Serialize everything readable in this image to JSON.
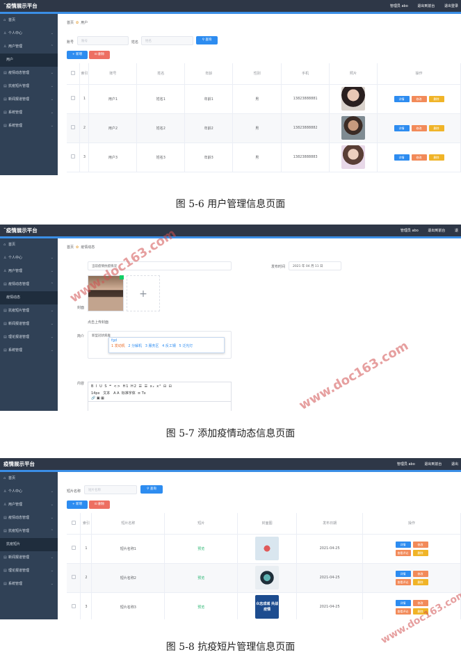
{
  "fig1": {
    "app_title": "ˉ疫情展示平台",
    "header_links": [
      "管理员 abo",
      "退出到前台",
      "退出登录"
    ],
    "sidebar": [
      "首页",
      "个人中心",
      "用户管理",
      "用户",
      "疫情动态管理",
      "抗疫短片管理",
      "新闻报道管理",
      "系统管理",
      "系统管理"
    ],
    "breadcrumb": {
      "home": "首页",
      "current": "用户"
    },
    "search": {
      "account_label": "账号",
      "account_placeholder": "账号",
      "name_label": "姓名",
      "name_placeholder": "姓名",
      "query_btn": "查询"
    },
    "actions": {
      "add": "新增",
      "delete": "删除"
    },
    "columns": [
      "索引",
      "账号",
      "姓名",
      "年龄",
      "性别",
      "手机",
      "照片",
      "操作"
    ],
    "rows": [
      {
        "idx": "1",
        "account": "用户1",
        "name": "姓名1",
        "age": "年龄1",
        "sex": "男",
        "phone": "13823888881"
      },
      {
        "idx": "2",
        "account": "用户2",
        "name": "姓名2",
        "age": "年龄2",
        "sex": "男",
        "phone": "13823888882"
      },
      {
        "idx": "3",
        "account": "用户3",
        "name": "姓名3",
        "age": "年龄3",
        "sex": "男",
        "phone": "13823888883"
      }
    ],
    "row_ops": [
      "详情",
      "修改",
      "删除"
    ],
    "caption": "图 5-6 用户管理信息页面"
  },
  "fig2": {
    "app_title": "ˉ疫情展示平台",
    "header_links": [
      "管理员 abo",
      "退出到前台",
      "退"
    ],
    "sidebar": [
      "首页",
      "个人中心",
      "用户管理",
      "疫情动态管理",
      "疫情动态",
      "抗疫短片管理",
      "新闻报道管理",
      "理论报道管理",
      "系统管理"
    ],
    "breadcrumb": {
      "home": "首页",
      "current": "疫情动态"
    },
    "title_value": "当前疫情抗疫情况",
    "date_label": "发布时间",
    "date_value": "2021 年 04 月 11 日",
    "cover_label": "封面",
    "cover_hint": "点击上传封面",
    "intro_label": "简介",
    "intro_value": "新型冠状病毒",
    "ime_input": "fgd",
    "ime_candidates": [
      "1 发动机",
      "2 分解机",
      "3 服务区",
      "4 反工钢",
      "5 泛光灯"
    ],
    "content_label": "内容",
    "editor_row1": [
      "B",
      "I",
      "U",
      "S",
      "❝",
      "<>",
      "H1",
      "H2",
      "☰",
      "☰",
      "x₂",
      "x²",
      "⊟",
      "⊟"
    ],
    "editor_row2": [
      "14px",
      "文本",
      "A",
      "A",
      "标准字体",
      "≡",
      "Tx"
    ],
    "caption": "图 5-7 添加疫情动态信息页面"
  },
  "fig3": {
    "app_title": "疫情展示平台",
    "header_links": [
      "管理员 abo",
      "退出到前台",
      "退出"
    ],
    "sidebar": [
      "首页",
      "个人中心",
      "用户管理",
      "疫情动态管理",
      "抗疫短片管理",
      "抗疫短片",
      "新闻报道管理",
      "理论报道管理",
      "系统管理"
    ],
    "search": {
      "label": "短片名称",
      "placeholder": "短片名称",
      "query_btn": "查询"
    },
    "actions": {
      "add": "新增",
      "delete": "删除"
    },
    "columns": [
      "索引",
      "短片名称",
      "短片",
      "封面图",
      "发布日期",
      "操作"
    ],
    "rows": [
      {
        "idx": "1",
        "name": "短片名称1",
        "video": "预览",
        "date": "2021-04-25"
      },
      {
        "idx": "2",
        "name": "短片名称2",
        "video": "预览",
        "date": "2021-04-25"
      },
      {
        "idx": "3",
        "name": "短片名称3",
        "video": "预览",
        "date": "2021-04-25"
      }
    ],
    "row_ops": [
      "详情",
      "修改",
      "查看评论",
      "删除"
    ],
    "cover3_text": "众志成城 共战疫情",
    "caption": "图 5-8 抗疫短片管理信息页面"
  },
  "watermark": [
    "www.doc163.com",
    "www.doc163.com",
    "www.doc163.com"
  ],
  "colors": {
    "topbar": "#2e3747",
    "sidebar": "#304156",
    "accent": "#3a8ee6"
  }
}
